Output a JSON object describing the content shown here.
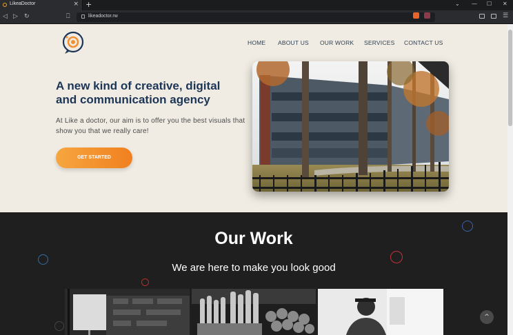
{
  "browser": {
    "tab_title": "LikeaDoctor",
    "tab_close": "×",
    "new_tab": "+",
    "url": "likeadoctor.rw",
    "window_controls": [
      "⌄",
      "—",
      "☐",
      "✕"
    ],
    "back": "◁",
    "forward": "▷",
    "reload": "↻",
    "bookmark": "⎕",
    "menu": "☰"
  },
  "nav": {
    "items": [
      "HOME",
      "ABOUT US",
      "OUR WORK",
      "SERVICES",
      "CONTACT US"
    ]
  },
  "hero": {
    "title": "A new kind of creative, digital and communication agency",
    "text": "At Like a doctor, our aim is to offer you the best visuals that show you that we really care!",
    "cta": "GET STARTED"
  },
  "work": {
    "title": "Our Work",
    "subtitle": "We are here to make you look good"
  },
  "scroll_to_top": "^",
  "colors": {
    "accent_orange": "#f29031",
    "heading_navy": "#1c3557",
    "hero_bg": "#f0ece3",
    "dark_bg": "#1f1f1f"
  },
  "icons": [
    "logo-icon",
    "favicon-icon",
    "lock-icon",
    "brave-shield-icon",
    "brave-rewards-icon"
  ]
}
